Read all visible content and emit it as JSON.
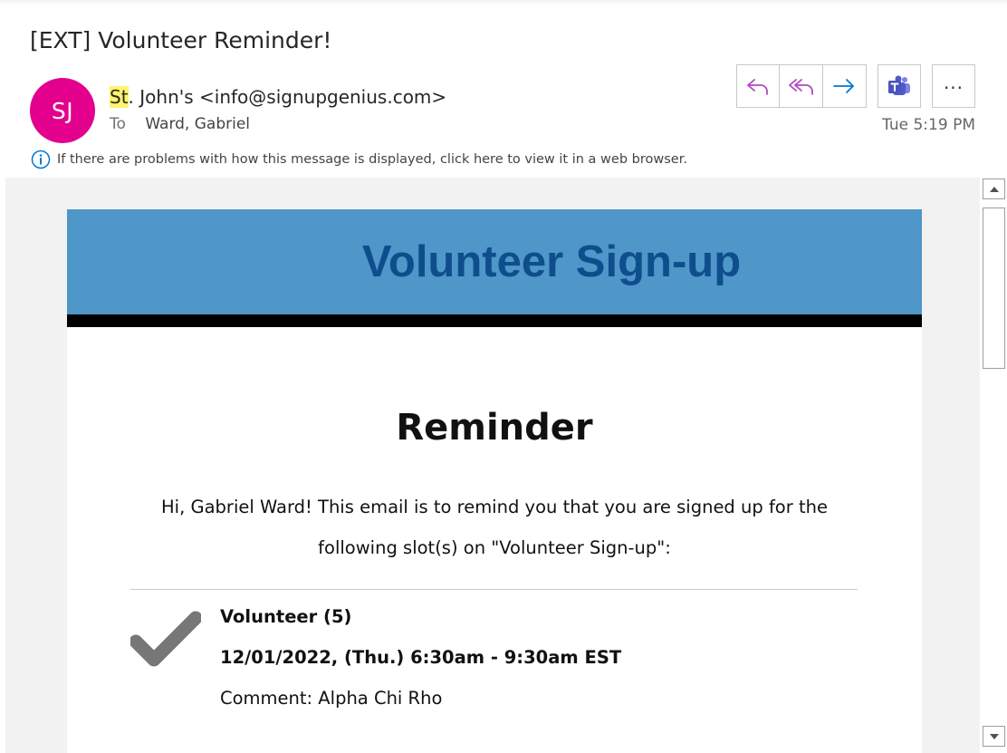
{
  "message": {
    "subject": "[EXT] Volunteer Reminder!",
    "avatar_initials": "SJ",
    "sender_highlight": "St",
    "sender_rest": ". John's <info@signupgenius.com>",
    "to_label": "To",
    "to_name": "Ward, Gabriel",
    "timestamp": "Tue 5:19 PM",
    "info_text": "If there are problems with how this message is displayed, click here to view it in a web browser."
  },
  "toolbar": {
    "icons": [
      "reply-icon",
      "reply-all-icon",
      "forward-icon",
      "teams-icon",
      "more-options-icon"
    ],
    "more_label": "..."
  },
  "email": {
    "banner_title": "Volunteer Sign-up",
    "heading": "Reminder",
    "intro_line1": "Hi, Gabriel Ward! This email is to remind you that you are signed up for the",
    "intro_line2": "following slot(s) on \"Volunteer Sign-up\":",
    "slot": {
      "name": "Volunteer (5)",
      "datetime": "12/01/2022, (Thu.) 6:30am - 9:30am EST",
      "comment": "Comment: Alpha Chi Rho"
    }
  },
  "colors": {
    "avatar": "#e3008c",
    "banner": "#4f96c9",
    "banner_text": "#0f4e8c",
    "reply_icons": "#b146c2",
    "forward_icon": "#0078d4",
    "checkmark": "#777777",
    "highlight": "#fff36b"
  }
}
